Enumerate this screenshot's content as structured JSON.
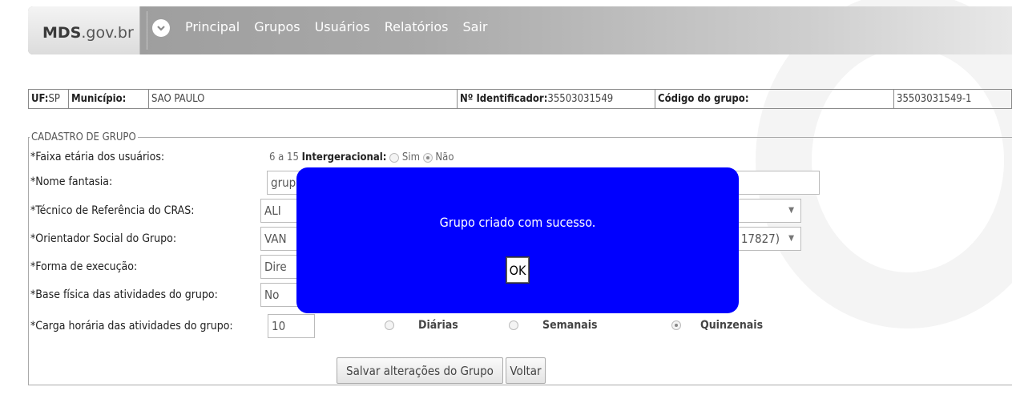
{
  "nav": {
    "logo_bold": "MDS",
    "logo_rest": ".gov.br",
    "items": [
      "Principal",
      "Grupos",
      "Usuários",
      "Relatórios",
      "Sair"
    ]
  },
  "info": {
    "uf_label": "UF:",
    "uf_value": "SP",
    "municipio_label": "Município:",
    "municipio_value": "SAO PAULO",
    "identificador_label": "Nº Identificador:",
    "identificador_value": "35503031549",
    "codigo_label": "Código do grupo:",
    "codigo_value": "35503031549-1"
  },
  "form": {
    "legend": "CADASTRO DE GRUPO",
    "faixa_label": "*Faixa etária dos usuários:",
    "faixa_value": "6 a 15",
    "intergeracional_label": "Intergeracional:",
    "sim_label": "Sim",
    "nao_label": "Não",
    "nome_label": "*Nome fantasia:",
    "nome_value": "grup",
    "tecnico_label": "*Técnico de Referência do CRAS:",
    "tecnico_value": "ALI",
    "orientador_label": "*Orientador Social do Grupo:",
    "orientador_value": "VAN",
    "orientador_suffix": "17827)",
    "forma_label": "*Forma de execução:",
    "forma_value": "Dire",
    "base_label": "*Base física das atividades do grupo:",
    "base_value": "No",
    "carga_label": "*Carga horária das atividades do grupo:",
    "carga_value": "10",
    "diarias_label": "Diárias",
    "semanais_label": "Semanais",
    "quinzenais_label": "Quinzenais",
    "save_button": "Salvar alterações do Grupo",
    "back_button": "Voltar"
  },
  "modal": {
    "message": "Grupo criado com sucesso.",
    "ok_label": "OK",
    "background_color": "#0000ff"
  }
}
